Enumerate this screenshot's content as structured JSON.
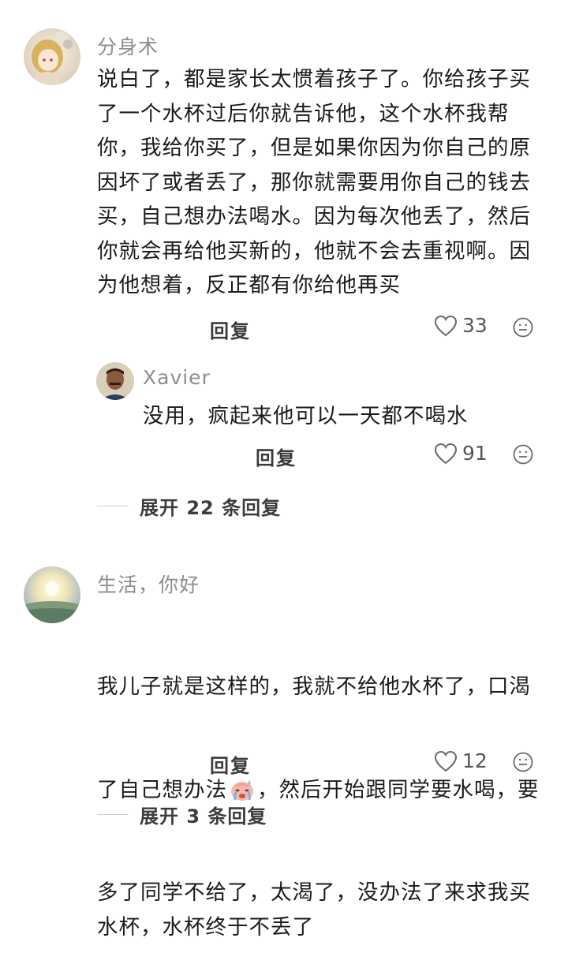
{
  "comments": [
    {
      "username": "分身术",
      "text": "说白了，都是家长太惯着孩子了。你给孩子买\n了一个水杯过后你就告诉他，这个水杯我帮\n你，我给你买了，但是如果你因为你自己的原\n因坏了或者丢了，那你就需要用你自己的钱去\n买，自己想办法喝水。因为每次他丢了，然后\n你就会再给他买新的，他就不会去重视啊。因\n为他想着，反正都有你给他再买",
      "reply_label": "回复",
      "likes": "33",
      "replies": [
        {
          "username": "Xavier",
          "text": "没用，疯起来他可以一天都不喝水",
          "reply_label": "回复",
          "likes": "91"
        }
      ],
      "expand_label": "展开 22 条回复"
    },
    {
      "username": "生活，你好",
      "text_line1": "我儿子就是这样的，我就不给他水杯了，口渴",
      "text_line2a": "了自己想办法",
      "text_line2b": "，然后开始跟同学要水喝，要",
      "text_rest": "多了同学不给了，太渴了，没办法了来求我买\n水杯，水杯终于不丢了",
      "reply_label": "回复",
      "likes": "12",
      "expand_label": "展开 3 条回复"
    }
  ],
  "icons": {
    "like": "heart-outline-icon",
    "emoji": "smiley-face-icon",
    "crying": "crying-face-emoji"
  },
  "colors": {
    "username": "#8d8d8d",
    "text": "#1b1b1b",
    "icon": "#6a6a6a"
  }
}
